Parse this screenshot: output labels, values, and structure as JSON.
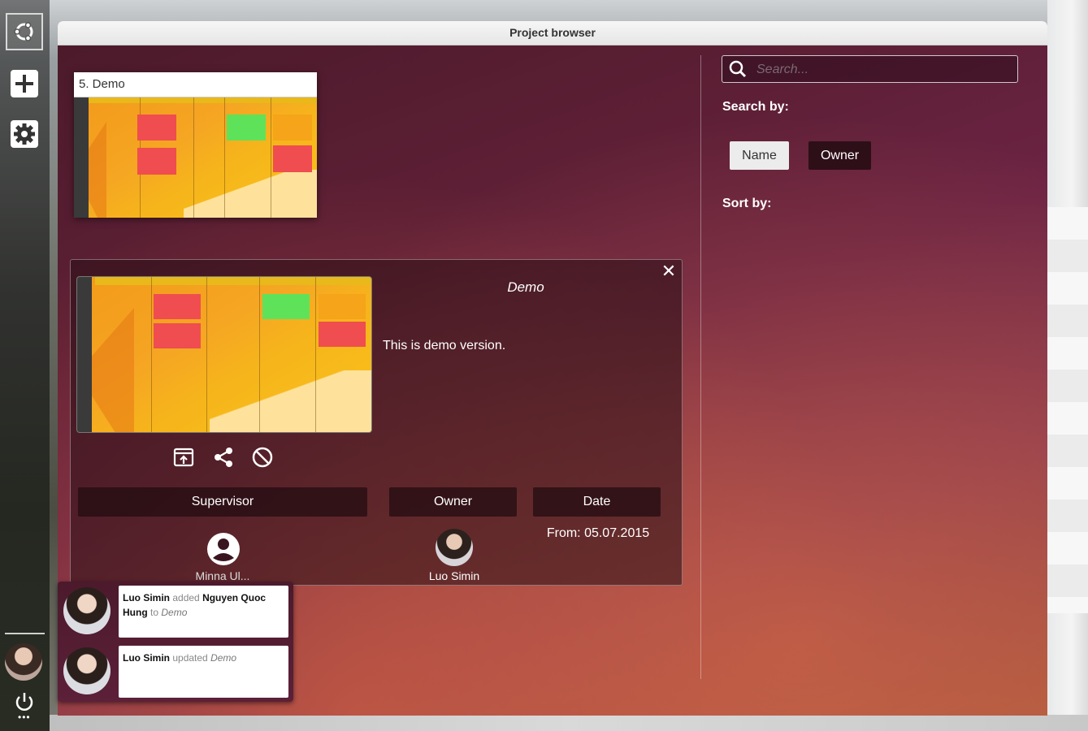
{
  "window": {
    "title": "Project browser"
  },
  "project_card": {
    "title": "5. Demo"
  },
  "detail": {
    "name": "Demo",
    "description": "This is demo version.",
    "headers": {
      "supervisor": "Supervisor",
      "owner": "Owner",
      "date": "Date"
    },
    "supervisor_name": "Minna Ul...",
    "owner_name": "Luo Simin",
    "date_from": "From: 05.07.2015"
  },
  "search": {
    "placeholder": "Search..."
  },
  "search_by": {
    "label": "Search by:",
    "name_btn": "Name",
    "owner_btn": "Owner"
  },
  "sort_by": {
    "label": "Sort by:"
  },
  "notifications": [
    {
      "actor": "Luo Simin",
      "verb": "added",
      "object": "Nguyen Quoc Hung",
      "prep": "to",
      "target": "Demo"
    },
    {
      "actor": "Luo Simin",
      "verb": "updated",
      "target": "Demo"
    }
  ],
  "icons": [
    "ubuntu-icon",
    "plus-icon",
    "gear-icon",
    "power-icon",
    "search-icon",
    "close-icon",
    "open-icon",
    "share-icon",
    "block-icon",
    "account-icon"
  ],
  "colors": {
    "accent_dark": "#2a0d16",
    "window_gradient_start": "#4a1a2a",
    "window_gradient_end": "#a8573f"
  }
}
